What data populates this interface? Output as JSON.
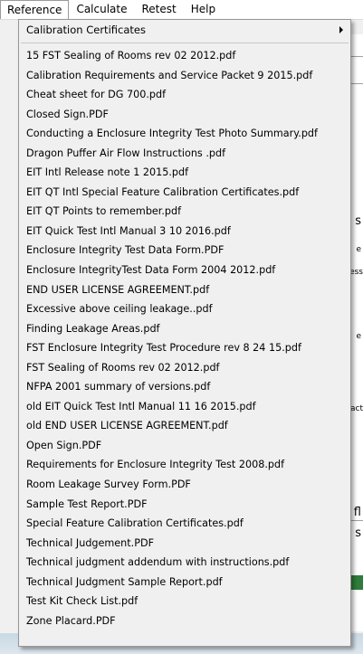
{
  "menubar": {
    "items": [
      {
        "label": "Reference",
        "active": true
      },
      {
        "label": "Calculate"
      },
      {
        "label": "Retest"
      },
      {
        "label": "Help"
      }
    ]
  },
  "dropdown": {
    "submenu_label": "Calibration Certificates",
    "files": [
      "15 FST Sealing of Rooms rev 02 2012.pdf",
      "Calibration Requirements and Service  Packet 9 2015.pdf",
      "Cheat sheet for DG 700.pdf",
      "Closed Sign.PDF",
      "Conducting a Enclosure Integrity Test Photo Summary.pdf",
      "Dragon Puffer Air Flow Instructions .pdf",
      "EIT Intl Release note 1 2015.pdf",
      "EIT QT Intl Special Feature Calibration Certificates.pdf",
      "EIT QT Points to remember.pdf",
      "EIT Quick Test Intl Manual 3 10 2016.pdf",
      "Enclosure Integrity Test Data Form.PDF",
      "Enclosure IntegrityTest Data Form 2004 2012.pdf",
      "END USER LICENSE AGREEMENT.pdf",
      "Excessive above ceiling leakage..pdf",
      "Finding Leakage Areas.pdf",
      "FST Enclosure Integrity Test Procedure  rev 8 24 15.pdf",
      "FST Sealing of Rooms rev 02 2012.pdf",
      "NFPA 2001 summary of versions.pdf",
      "old EIT Quick Test Intl  Manual  11 16  2015.pdf",
      "old END USER LICENSE AGREEMENT.pdf",
      "Open Sign.PDF",
      "Requirements for Enclosure Integrity Test 2008.pdf",
      "Room Leakage Survey Form.PDF",
      "Sample Test Report.PDF",
      "Special Feature Calibration Certificates.pdf",
      "Technical Judgement.PDF",
      "Technical judgment addendum with instructions.pdf",
      "Technical Judgment Sample Report.pdf",
      "Test Kit Check List.pdf",
      "Zone Placard.PDF"
    ]
  },
  "background": {
    "fragments": [
      "s",
      "e",
      "ess",
      "e",
      "act",
      "fl",
      "s"
    ]
  }
}
